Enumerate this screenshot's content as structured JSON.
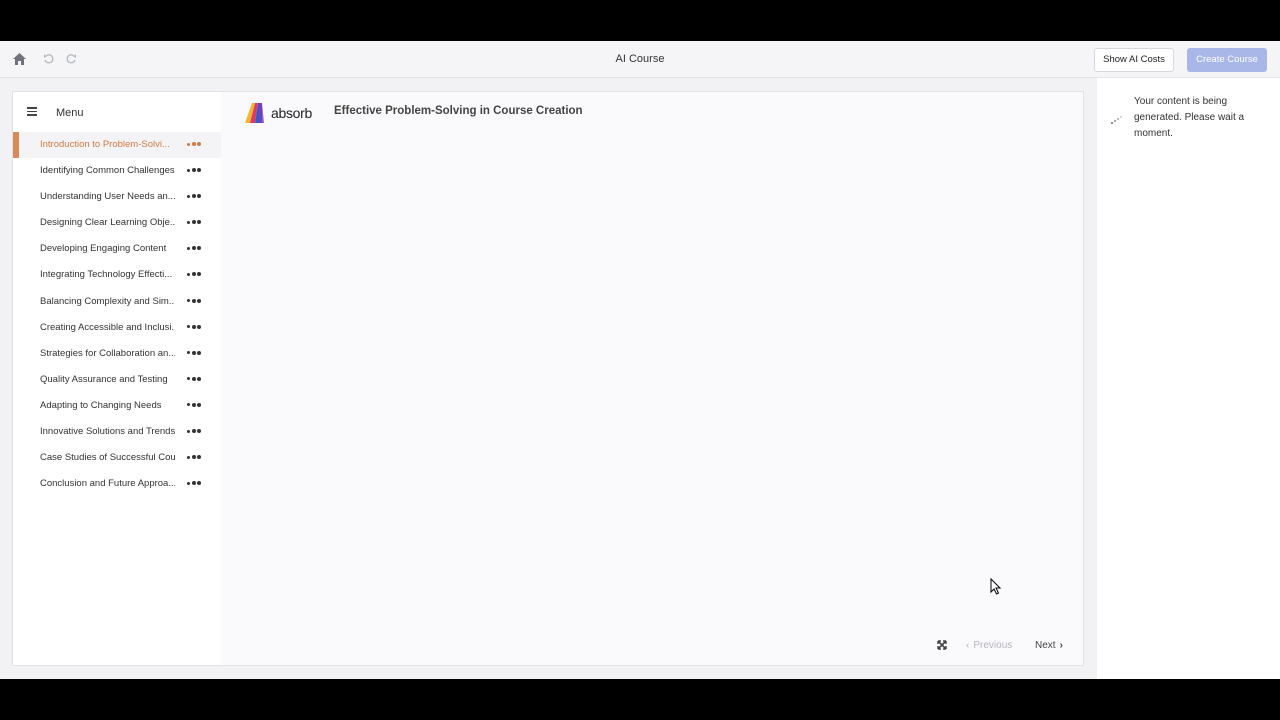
{
  "topbar": {
    "title": "AI Course",
    "show_costs_label": "Show AI Costs",
    "create_course_label": "Create Course"
  },
  "sidebar": {
    "menu_label": "Menu",
    "items": [
      {
        "label": "Introduction to Problem-Solvi...",
        "active": true
      },
      {
        "label": "Identifying Common Challenges"
      },
      {
        "label": "Understanding User Needs an..."
      },
      {
        "label": "Designing Clear Learning Obje..."
      },
      {
        "label": "Developing Engaging Content"
      },
      {
        "label": "Integrating Technology Effecti..."
      },
      {
        "label": "Balancing Complexity and Sim..."
      },
      {
        "label": "Creating Accessible and Inclusi..."
      },
      {
        "label": "Strategies for Collaboration an..."
      },
      {
        "label": "Quality Assurance and Testing"
      },
      {
        "label": "Adapting to Changing Needs"
      },
      {
        "label": "Innovative Solutions and Trends"
      },
      {
        "label": "Case Studies of Successful Cou..."
      },
      {
        "label": "Conclusion and Future Approa..."
      }
    ]
  },
  "content": {
    "logo_text": "absorb",
    "course_title": "Effective Problem-Solving in Course Creation",
    "previous_label": "Previous",
    "next_label": "Next"
  },
  "side_panel": {
    "message": "Your content is being generated. Please wait a moment."
  },
  "colors": {
    "accent": "#d17a45",
    "create_button": "#a8b6e8"
  }
}
